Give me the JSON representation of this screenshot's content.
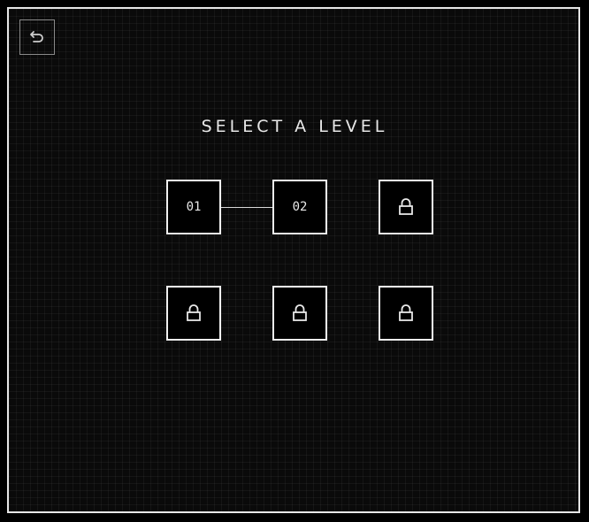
{
  "title": "SELECT A LEVEL",
  "back_button": {
    "icon": "undo-arrow-icon"
  },
  "levels": [
    {
      "label": "01",
      "locked": false
    },
    {
      "label": "02",
      "locked": false
    },
    {
      "label": "",
      "locked": true,
      "icon": "lock-icon"
    },
    {
      "label": "",
      "locked": true,
      "icon": "lock-icon"
    },
    {
      "label": "",
      "locked": true,
      "icon": "lock-icon"
    },
    {
      "label": "",
      "locked": true,
      "icon": "lock-icon"
    }
  ],
  "colors": {
    "background": "#000000",
    "border": "#e6e6e6",
    "text": "#e8e8e8"
  }
}
